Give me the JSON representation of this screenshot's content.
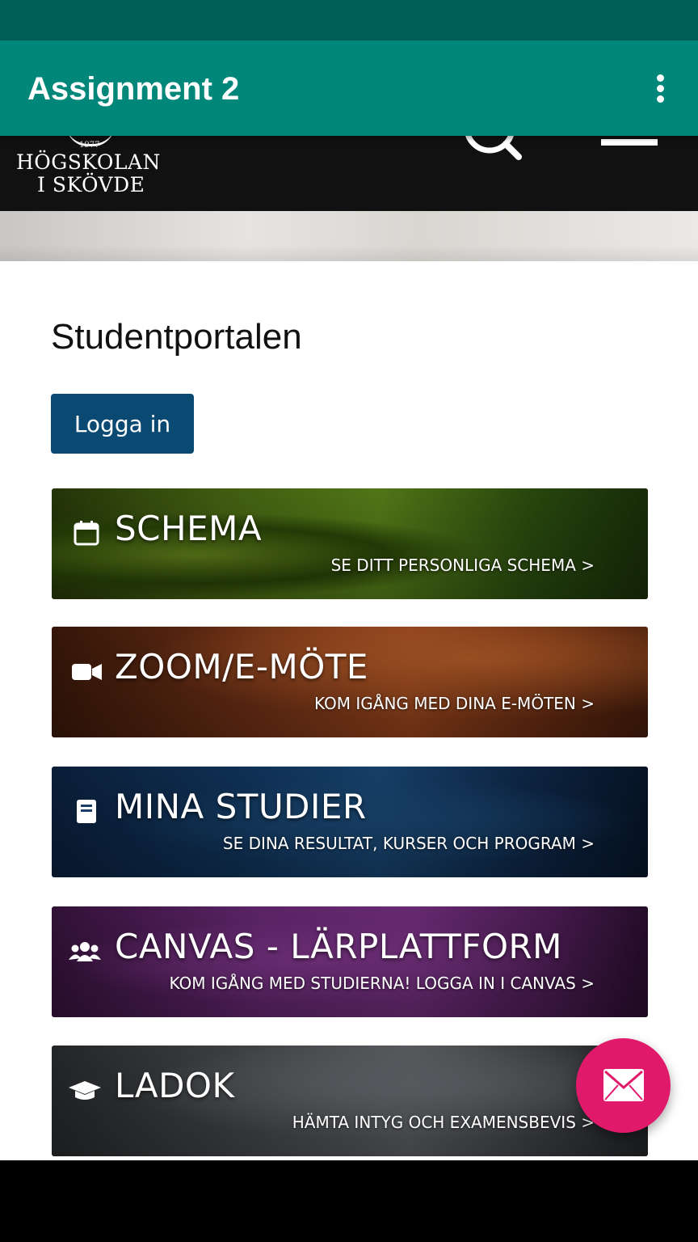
{
  "app_bar": {
    "title": "Assignment 2",
    "overflow_icon": "more-vert-icon",
    "background": "#00877a",
    "status_bar_color": "#005f57"
  },
  "site_header": {
    "logo": {
      "year": "1977",
      "line1": "HÖGSKOLAN",
      "line2": "I SKÖVDE"
    },
    "search_icon": "search-icon",
    "menu_icon": "hamburger-menu-icon"
  },
  "main": {
    "title": "Studentportalen",
    "login_button": "Logga in"
  },
  "tiles": [
    {
      "icon": "calendar-icon",
      "title": "SCHEMA",
      "subtitle": "SE DITT PERSONLIGA SCHEMA >"
    },
    {
      "icon": "video-camera-icon",
      "title": "ZOOM/E-MÖTE",
      "subtitle": "KOM IGÅNG MED DINA E-MÖTEN >"
    },
    {
      "icon": "book-icon",
      "title": "MINA STUDIER",
      "subtitle": "SE DINA RESULTAT, KURSER OCH PROGRAM >"
    },
    {
      "icon": "group-icon",
      "title": "CANVAS - LÄRPLATTFORM",
      "subtitle": "KOM IGÅNG MED STUDIERNA! LOGGA IN I CANVAS >"
    },
    {
      "icon": "graduation-cap-icon",
      "title": "LADOK",
      "subtitle": "HÄMTA INTYG OCH EXAMENSBEVIS >"
    }
  ],
  "fab": {
    "icon": "mail-icon",
    "color": "#e0196a"
  },
  "colors": {
    "login_button": "#0a4a72"
  }
}
